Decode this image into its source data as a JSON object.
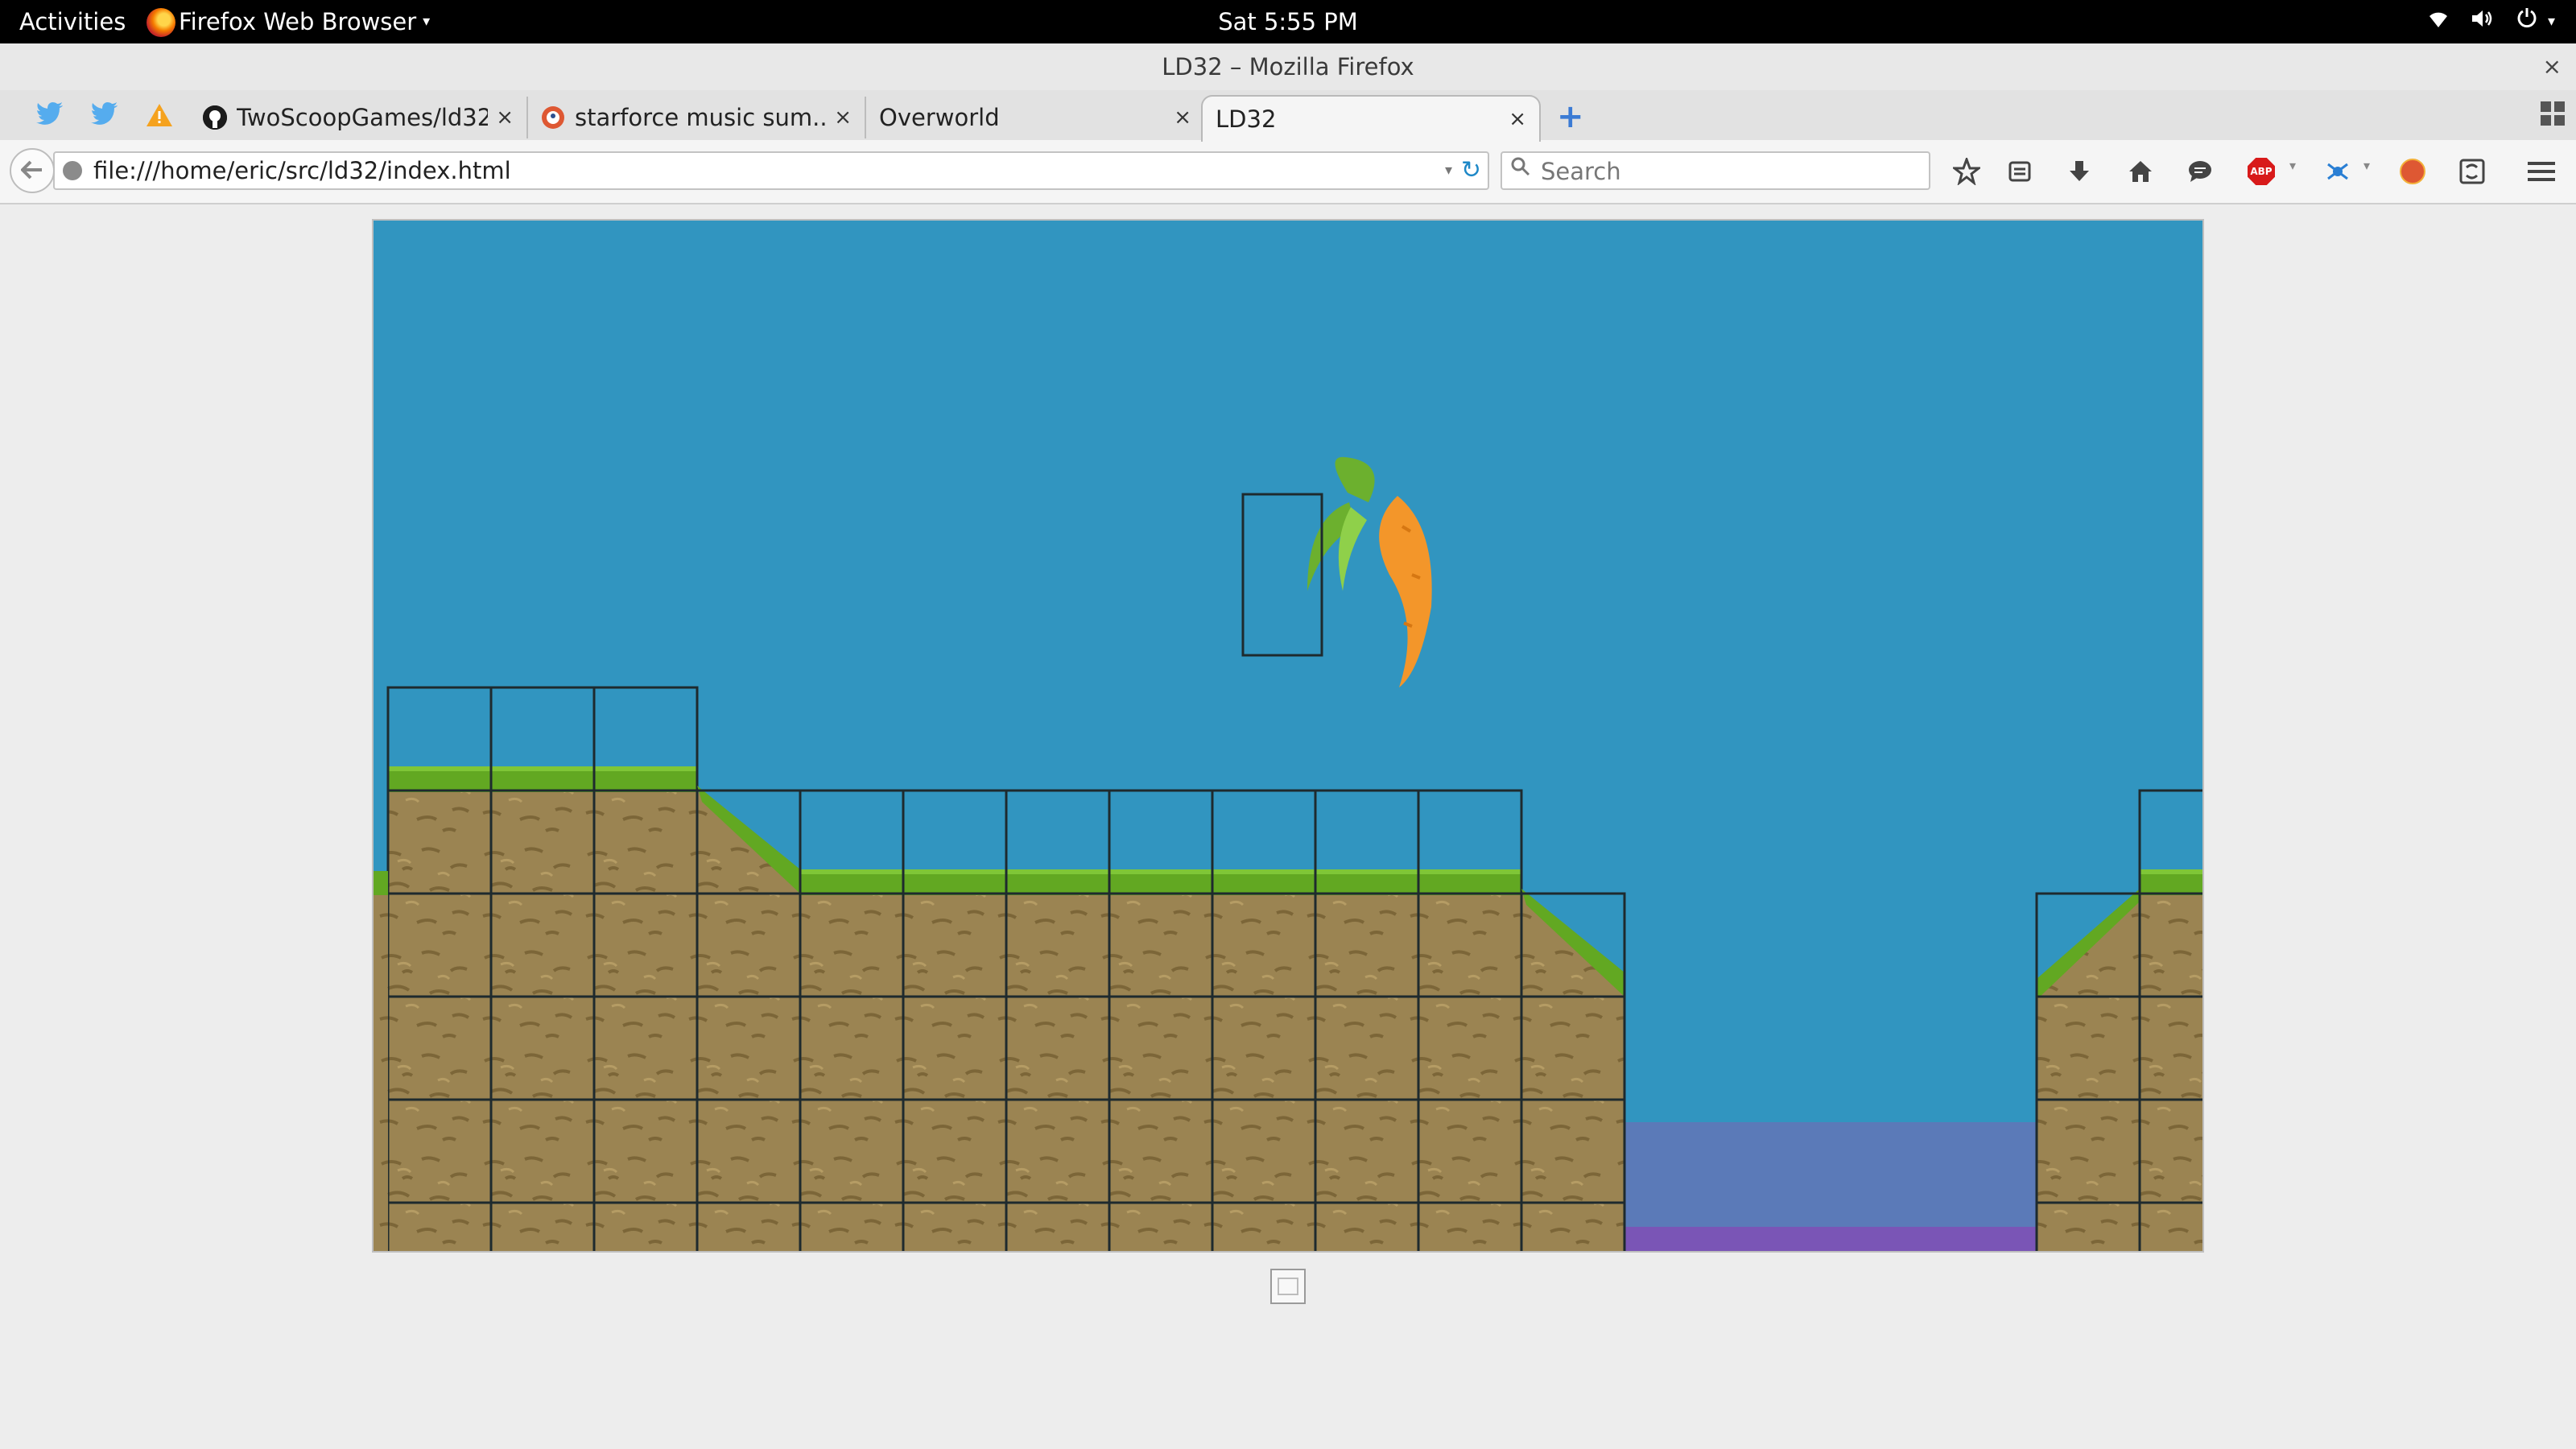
{
  "topbar": {
    "activities": "Activities",
    "app_menu": "Firefox Web Browser",
    "clock": "Sat  5:55 PM",
    "icons": [
      "wifi-icon",
      "volume-icon",
      "power-icon"
    ]
  },
  "window": {
    "title": "LD32 – Mozilla Firefox",
    "close_glyph": "×"
  },
  "tabs": {
    "pinned": [
      "twitter-icon",
      "twitter-icon",
      "warning-icon"
    ],
    "open": [
      {
        "label": "TwoScoopGames/ld32",
        "favicon": "github-icon"
      },
      {
        "label": "starforce music sum...",
        "favicon": "duckduckgo-icon"
      },
      {
        "label": "Overworld",
        "favicon": ""
      },
      {
        "label": "LD32",
        "favicon": "",
        "active": true
      }
    ],
    "close_glyph": "×",
    "new_tab_glyph": "+"
  },
  "navbar": {
    "url": "file:///home/eric/src/ld32/index.html",
    "search_placeholder": "Search",
    "toolbar_icons": [
      "bookmark-star-icon",
      "reading-list-icon",
      "download-icon",
      "home-icon",
      "chat-icon",
      "adblock-plus-icon",
      "extension-icon",
      "duckduckgo-icon",
      "screenshot-icon",
      "menu-icon"
    ],
    "adblock_label": "ABP"
  },
  "game": {
    "colors": {
      "sky": "#3195c0",
      "water": "#5b7ab8",
      "water_bottom": "#7a55b6",
      "dirt": "#9b8452",
      "grass": "#62a822",
      "grid_line": "#1e2a2e",
      "carrot": "#f3962a",
      "carrot_leaf": "#6cb02e"
    },
    "player": "carrot-sprite"
  }
}
